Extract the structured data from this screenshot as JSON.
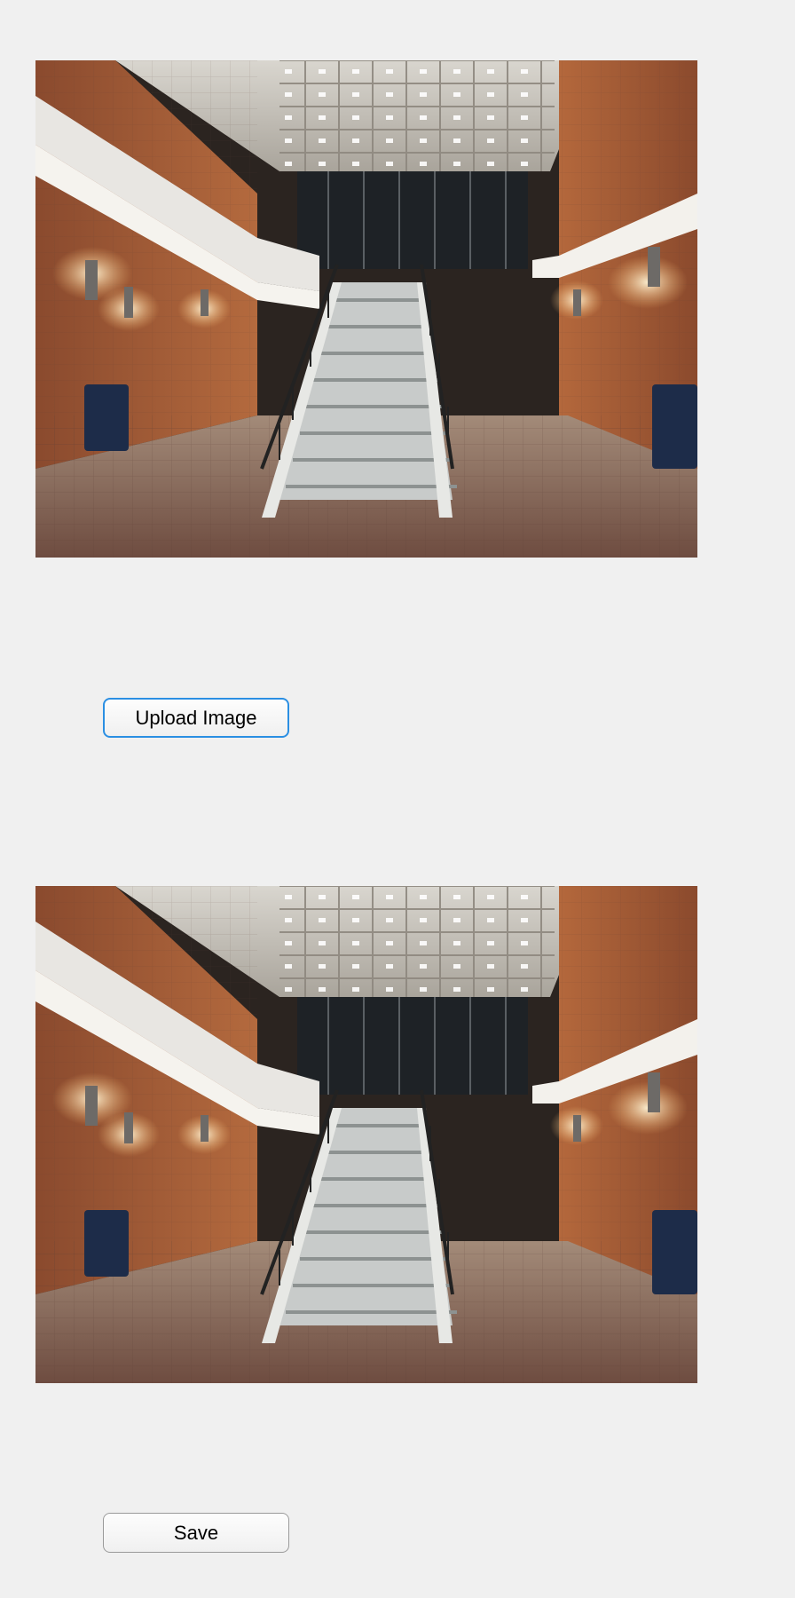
{
  "buttons": {
    "upload_label": "Upload Image",
    "save_label": "Save"
  },
  "images": {
    "original": {
      "subject": "stairwell-photo"
    },
    "processed": {
      "subject": "stairwell-photo"
    }
  },
  "colors": {
    "background": "#f0f0f0",
    "focus_border": "#2b8fe3",
    "button_border": "#9a9a9a"
  }
}
